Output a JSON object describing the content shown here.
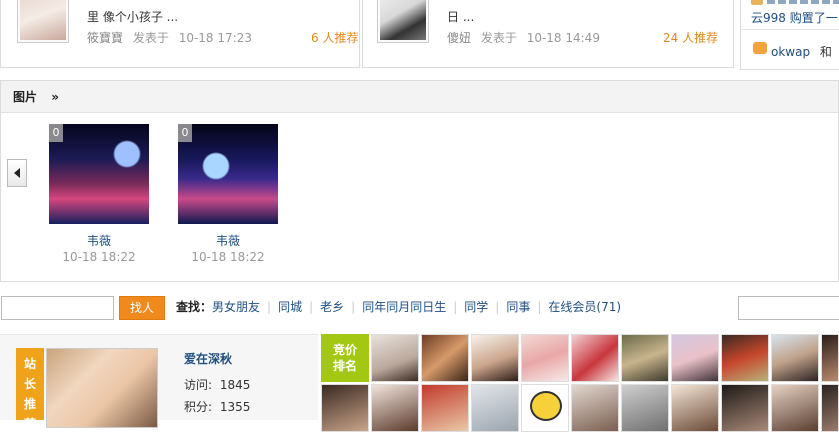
{
  "blogs": [
    {
      "text_line1": "里 像个小孩子 ...",
      "author": "筱寶寶",
      "posted_label": "发表于",
      "time": "10-18 17:23",
      "recommend": "6 人推荐"
    },
    {
      "text_line1": "日 ...",
      "author": "傻妞",
      "posted_label": "发表于",
      "time": "10-18 14:49",
      "recommend": "24 人推荐"
    }
  ],
  "side": {
    "line1": "云998 购置了一",
    "line2_name": "okwap",
    "line2_rest": "和"
  },
  "photos_section": {
    "title": "图片",
    "more": "»",
    "items": [
      {
        "count": "0",
        "caption": "韦薇",
        "time": "10-18 18:22"
      },
      {
        "count": "0",
        "caption": "韦薇",
        "time": "10-18 18:22"
      }
    ]
  },
  "search": {
    "button": "找人",
    "find_label": "查找：",
    "links": [
      "男女朋友",
      "同城",
      "老乡",
      "同年同月同日生",
      "同学",
      "同事",
      "在线会员(71)"
    ]
  },
  "featured": {
    "ribbon": [
      "站",
      "长",
      "推",
      "荐"
    ],
    "name": "爱在深秋",
    "visits_label": "访问:",
    "visits": "1845",
    "points_label": "积分:",
    "points": "1355"
  },
  "rank_badge": {
    "line1": "竞价",
    "line2": "排名"
  }
}
